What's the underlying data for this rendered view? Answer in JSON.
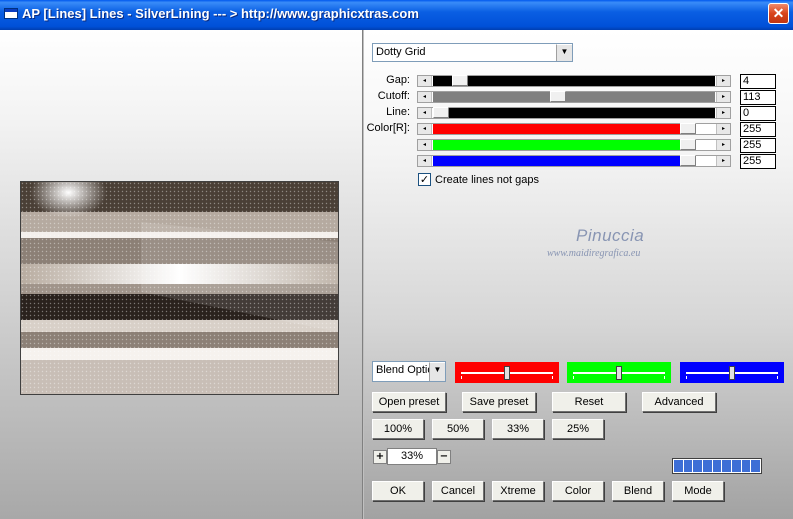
{
  "window": {
    "title": "AP [Lines]  Lines - SilverLining     --- > http://www.graphicxtras.com",
    "close_symbol": "✕"
  },
  "filter": {
    "preset_dropdown": "Dotty Grid",
    "checkbox_label": "Create lines not gaps",
    "checkbox_checked": true
  },
  "params": [
    {
      "label": "Gap:",
      "value": "4",
      "color": "#000000",
      "fill_fraction": 1.0,
      "thumb_fraction": 0.07
    },
    {
      "label": "Cutoff:",
      "value": "113",
      "color": "#808080",
      "fill_fraction": 1.0,
      "thumb_fraction": 0.44
    },
    {
      "label": "Line:",
      "value": "0",
      "color": "#000000",
      "fill_fraction": 1.0,
      "thumb_fraction": 0.0
    },
    {
      "label": "Color[R]:",
      "value": "255",
      "color": "#ff0000",
      "fill_fraction": 0.93,
      "thumb_fraction": 0.93
    },
    {
      "label": "",
      "value": "255",
      "color": "#00ff00",
      "fill_fraction": 0.93,
      "thumb_fraction": 0.93
    },
    {
      "label": "",
      "value": "255",
      "color": "#0000ff",
      "fill_fraction": 0.93,
      "thumb_fraction": 0.93
    }
  ],
  "watermark": {
    "name": "Pinuccia",
    "site": "www.maidiregrafica.eu"
  },
  "blend_dropdown": "Blend Optio",
  "channels": [
    {
      "name": "red",
      "color": "#ff0000",
      "level": 0.5
    },
    {
      "name": "green",
      "color": "#00ff00",
      "level": 0.5
    },
    {
      "name": "blue",
      "color": "#0000ff",
      "level": 0.5
    }
  ],
  "buttons": {
    "open_preset": "Open preset",
    "save_preset": "Save preset",
    "reset": "Reset",
    "advanced": "Advanced",
    "zoom_100": "100%",
    "zoom_50": "50%",
    "zoom_33": "33%",
    "zoom_25": "25%",
    "zoom_plus": "+",
    "zoom_minus": "−",
    "ok": "OK",
    "cancel": "Cancel",
    "xtreme": "Xtreme",
    "color": "Color",
    "blend": "Blend",
    "mode": "Mode"
  },
  "zoom_value": "33%",
  "progress": {
    "segments": 9,
    "filled": 9
  }
}
